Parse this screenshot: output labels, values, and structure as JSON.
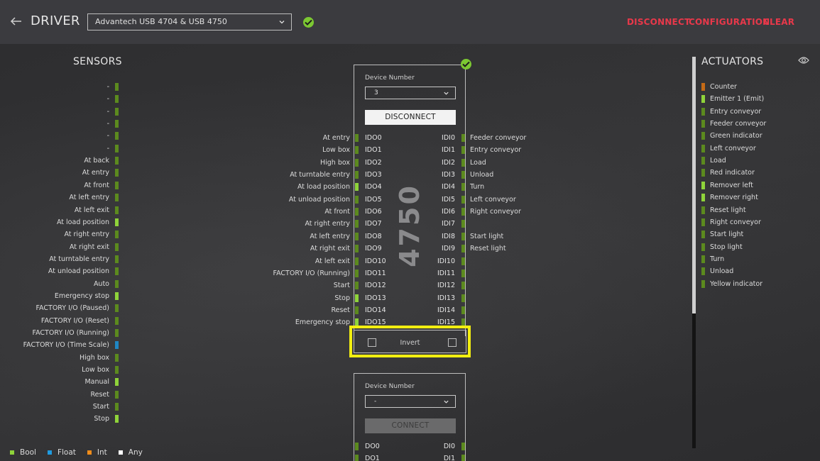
{
  "header": {
    "title": "DRIVER",
    "driver_value": "Advantech USB 4704 & USB 4750",
    "buttons": [
      "DISCONNECT",
      "CONFIGURATION",
      "CLEAR"
    ]
  },
  "colors": {
    "accent_red": "#e8384a",
    "ok_green": "#7cc832",
    "bool_on": "#8fd33a",
    "bool_off": "#5c8a1e",
    "float": "#1f86c4",
    "int": "#c46a16",
    "highlight": "#f2ee10"
  },
  "sensors": {
    "title": "SENSORS",
    "items": [
      {
        "label": "-",
        "type": "bool",
        "on": false
      },
      {
        "label": "-",
        "type": "bool",
        "on": false
      },
      {
        "label": "-",
        "type": "bool",
        "on": false
      },
      {
        "label": "-",
        "type": "bool",
        "on": false
      },
      {
        "label": "-",
        "type": "bool",
        "on": false
      },
      {
        "label": "-",
        "type": "bool",
        "on": false
      },
      {
        "label": "At back",
        "type": "bool",
        "on": false
      },
      {
        "label": "At entry",
        "type": "bool",
        "on": false
      },
      {
        "label": "At front",
        "type": "bool",
        "on": false
      },
      {
        "label": "At left entry",
        "type": "bool",
        "on": false
      },
      {
        "label": "At left exit",
        "type": "bool",
        "on": false
      },
      {
        "label": "At load position",
        "type": "bool",
        "on": true
      },
      {
        "label": "At right entry",
        "type": "bool",
        "on": false
      },
      {
        "label": "At right exit",
        "type": "bool",
        "on": false
      },
      {
        "label": "At turntable entry",
        "type": "bool",
        "on": false
      },
      {
        "label": "At unload position",
        "type": "bool",
        "on": false
      },
      {
        "label": "Auto",
        "type": "bool",
        "on": false
      },
      {
        "label": "Emergency stop",
        "type": "bool",
        "on": true
      },
      {
        "label": "FACTORY I/O (Paused)",
        "type": "bool",
        "on": false
      },
      {
        "label": "FACTORY I/O (Reset)",
        "type": "bool",
        "on": false
      },
      {
        "label": "FACTORY I/O (Running)",
        "type": "bool",
        "on": false
      },
      {
        "label": "FACTORY I/O (Time Scale)",
        "type": "float",
        "on": false
      },
      {
        "label": "High box",
        "type": "bool",
        "on": false
      },
      {
        "label": "Low box",
        "type": "bool",
        "on": false
      },
      {
        "label": "Manual",
        "type": "bool",
        "on": true
      },
      {
        "label": "Reset",
        "type": "bool",
        "on": false
      },
      {
        "label": "Start",
        "type": "bool",
        "on": false
      },
      {
        "label": "Stop",
        "type": "bool",
        "on": true
      }
    ]
  },
  "device1": {
    "watermark": "4750",
    "device_number_label": "Device Number",
    "device_number_value": "3",
    "button_label": "DISCONNECT",
    "rows": [
      {
        "sensor": "At entry",
        "pin_out": "IDO0",
        "pin_in": "IDI0",
        "actuator": "Feeder conveyor",
        "on_l": false,
        "on_r": false
      },
      {
        "sensor": "Low box",
        "pin_out": "IDO1",
        "pin_in": "IDI1",
        "actuator": "Entry conveyor",
        "on_l": false,
        "on_r": false
      },
      {
        "sensor": "High box",
        "pin_out": "IDO2",
        "pin_in": "IDI2",
        "actuator": "Load",
        "on_l": false,
        "on_r": false
      },
      {
        "sensor": "At turntable entry",
        "pin_out": "IDO3",
        "pin_in": "IDI3",
        "actuator": "Unload",
        "on_l": false,
        "on_r": false
      },
      {
        "sensor": "At load position",
        "pin_out": "IDO4",
        "pin_in": "IDI4",
        "actuator": "Turn",
        "on_l": true,
        "on_r": false
      },
      {
        "sensor": "At unload position",
        "pin_out": "IDO5",
        "pin_in": "IDI5",
        "actuator": "Left conveyor",
        "on_l": false,
        "on_r": false
      },
      {
        "sensor": "At front",
        "pin_out": "IDO6",
        "pin_in": "IDI6",
        "actuator": "Right conveyor",
        "on_l": false,
        "on_r": false
      },
      {
        "sensor": "At right entry",
        "pin_out": "IDO7",
        "pin_in": "IDI7",
        "actuator": "",
        "on_l": false,
        "on_r": false
      },
      {
        "sensor": "At left entry",
        "pin_out": "IDO8",
        "pin_in": "IDI8",
        "actuator": "Start light",
        "on_l": false,
        "on_r": false
      },
      {
        "sensor": "At right exit",
        "pin_out": "IDO9",
        "pin_in": "IDI9",
        "actuator": "Reset light",
        "on_l": false,
        "on_r": false
      },
      {
        "sensor": "At left exit",
        "pin_out": "IDO10",
        "pin_in": "IDI10",
        "actuator": "",
        "on_l": false,
        "on_r": false
      },
      {
        "sensor": "FACTORY I/O (Running)",
        "pin_out": "IDO11",
        "pin_in": "IDI11",
        "actuator": "",
        "on_l": false,
        "on_r": false
      },
      {
        "sensor": "Start",
        "pin_out": "IDO12",
        "pin_in": "IDI12",
        "actuator": "",
        "on_l": false,
        "on_r": false
      },
      {
        "sensor": "Stop",
        "pin_out": "IDO13",
        "pin_in": "IDI13",
        "actuator": "",
        "on_l": true,
        "on_r": false
      },
      {
        "sensor": "Reset",
        "pin_out": "IDO14",
        "pin_in": "IDI14",
        "actuator": "",
        "on_l": false,
        "on_r": false
      },
      {
        "sensor": "Emergency stop",
        "pin_out": "IDO15",
        "pin_in": "IDI15",
        "actuator": "",
        "on_l": true,
        "on_r": false
      }
    ],
    "invert_label": "Invert",
    "invert_left_checked": false,
    "invert_right_checked": false
  },
  "device2": {
    "device_number_label": "Device Number",
    "device_number_value": "-",
    "button_label": "CONNECT",
    "rows": [
      {
        "pin_out": "DO0",
        "pin_in": "DI0"
      },
      {
        "pin_out": "DO1",
        "pin_in": "DI1"
      }
    ]
  },
  "actuators": {
    "title": "ACTUATORS",
    "items": [
      {
        "label": "Counter",
        "type": "int",
        "on": false
      },
      {
        "label": "Emitter 1 (Emit)",
        "type": "bool",
        "on": true
      },
      {
        "label": "Entry conveyor",
        "type": "bool",
        "on": false
      },
      {
        "label": "Feeder conveyor",
        "type": "bool",
        "on": false
      },
      {
        "label": "Green indicator",
        "type": "bool",
        "on": false
      },
      {
        "label": "Left conveyor",
        "type": "bool",
        "on": false
      },
      {
        "label": "Load",
        "type": "bool",
        "on": false
      },
      {
        "label": "Red indicator",
        "type": "bool",
        "on": false
      },
      {
        "label": "Remover left",
        "type": "bool",
        "on": true
      },
      {
        "label": "Remover right",
        "type": "bool",
        "on": true
      },
      {
        "label": "Reset light",
        "type": "bool",
        "on": false
      },
      {
        "label": "Right conveyor",
        "type": "bool",
        "on": false
      },
      {
        "label": "Start light",
        "type": "bool",
        "on": false
      },
      {
        "label": "Stop light",
        "type": "bool",
        "on": false
      },
      {
        "label": "Turn",
        "type": "bool",
        "on": false
      },
      {
        "label": "Unload",
        "type": "bool",
        "on": false
      },
      {
        "label": "Yellow indicator",
        "type": "bool",
        "on": false
      }
    ]
  },
  "legend": [
    {
      "label": "Bool",
      "color": "#8fd33a"
    },
    {
      "label": "Float",
      "color": "#1f9be0"
    },
    {
      "label": "Int",
      "color": "#f08c1a"
    },
    {
      "label": "Any",
      "color": "#ffffff"
    }
  ]
}
